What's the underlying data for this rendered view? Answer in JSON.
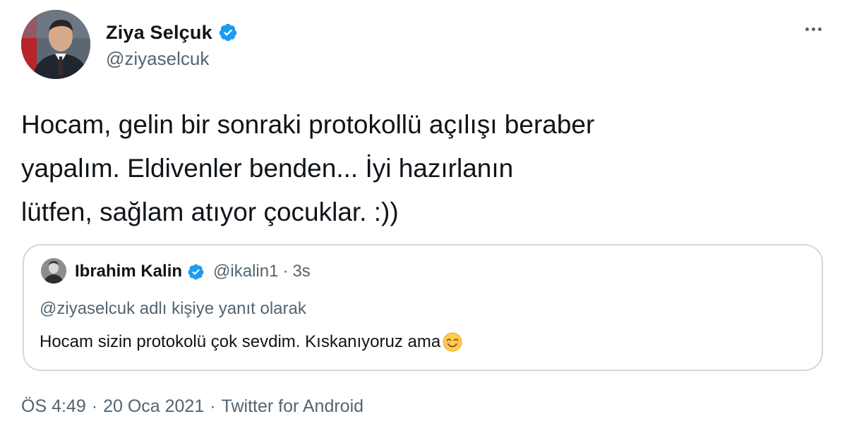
{
  "author": {
    "display_name": "Ziya Selçuk",
    "handle": "@ziyaselcuk",
    "avatar_icon": "avatar-photo",
    "verified_icon": "verified-badge-icon"
  },
  "tweet": {
    "text_lines": [
      "Hocam, gelin bir sonraki protokollü açılışı beraber",
      "yapalım. Eldivenler benden... İyi hazırlanın",
      "lütfen, sağlam atıyor çocuklar. :))"
    ]
  },
  "quoted_tweet": {
    "display_name": "Ibrahim Kalin",
    "handle": "@ikalin1",
    "separator": "·",
    "time": "3s",
    "reply_context": "@ziyaselcuk adlı kişiye yanıt olarak",
    "text": "Hocam sizin protokolü çok sevdim. Kıskanıyoruz ama",
    "emoji_icon": "smiling-face-emoji"
  },
  "meta": {
    "time": "ÖS 4:49",
    "separator": "·",
    "date": "20 Oca 2021",
    "source": "Twitter for Android"
  },
  "colors": {
    "verified": "#1d9bf0",
    "secondary_text": "#536471",
    "border": "#cfd9de"
  },
  "icons": {
    "more": "more-options-icon"
  }
}
